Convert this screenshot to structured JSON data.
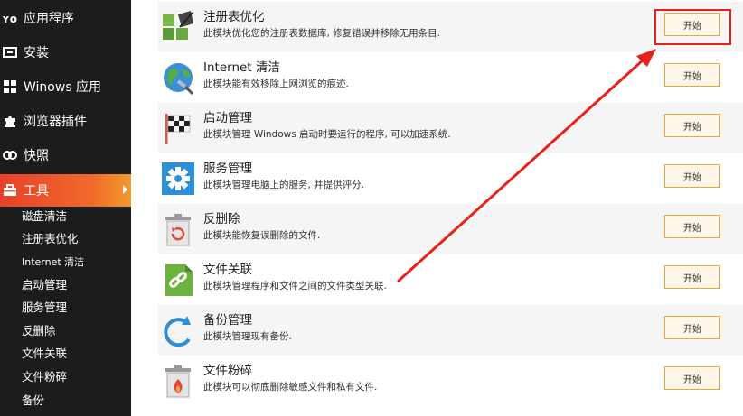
{
  "sidebar": {
    "items": [
      {
        "label": "应用程序",
        "icon": "apps-icon"
      },
      {
        "label": "安装",
        "icon": "install-icon"
      },
      {
        "label": "Winows 应用",
        "icon": "windows-icon"
      },
      {
        "label": "浏览器插件",
        "icon": "puzzle-icon"
      },
      {
        "label": "快照",
        "icon": "snapshot-icon"
      },
      {
        "label": "工具",
        "icon": "toolbox-icon",
        "active": true
      }
    ],
    "subitems": [
      "磁盘清洁",
      "注册表优化",
      "Internet 清洁",
      "启动管理",
      "服务管理",
      "反删除",
      "文件关联",
      "文件粉碎",
      "备份"
    ]
  },
  "tools": [
    {
      "title": "注册表优化",
      "desc": "此模块优化您的注册表数据库, 修复错误并移除无用条目.",
      "button": "开始",
      "icon": "registry-icon"
    },
    {
      "title": "Internet 清洁",
      "desc": "此模块能有效移除上网浏览的痕迹.",
      "button": "开始",
      "icon": "globe-icon"
    },
    {
      "title": "启动管理",
      "desc": "此模块管理 Windows 启动时要运行的程序, 可以加速系统.",
      "button": "开始",
      "icon": "checkered-flag-icon"
    },
    {
      "title": "服务管理",
      "desc": "此模块管理电脑上的服务, 并提供评分.",
      "button": "开始",
      "icon": "gear-icon"
    },
    {
      "title": "反删除",
      "desc": "此模块能恢复误删除的文件.",
      "button": "开始",
      "icon": "restore-bin-icon"
    },
    {
      "title": "文件关联",
      "desc": "此模块管理程序和文件之间的文件类型关联.",
      "button": "开始",
      "icon": "link-file-icon"
    },
    {
      "title": "备份管理",
      "desc": "此模块管理现有备份.",
      "button": "开始",
      "icon": "backup-icon"
    },
    {
      "title": "文件粉碎",
      "desc": "此模块可以彻底删除敏感文件和私有文件.",
      "button": "开始",
      "icon": "shredder-bin-icon"
    }
  ],
  "colors": {
    "sidebar_bg": "#1c1c1c",
    "active_accent": "#f06a2a",
    "button_border": "#f0a43a",
    "annotation": "#e8201a"
  }
}
